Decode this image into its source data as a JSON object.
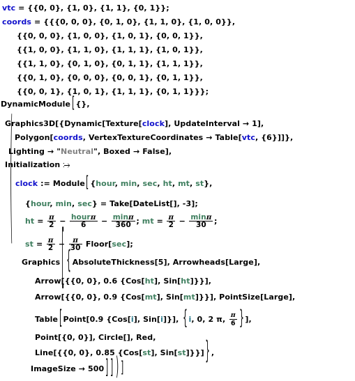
{
  "meta": {
    "app": "Wolfram Mathematica",
    "cell_type": "Input",
    "language": "Wolfram Language"
  },
  "colors": {
    "global_symbol": "#1111cc",
    "local_symbol": "#3f7f5f",
    "iterator_symbol": "#2b7a8c",
    "string_literal": "#808080",
    "default_text": "#000000",
    "background": "#ffffff"
  },
  "code": {
    "line01": {
      "name_vtc": "vtc",
      "rest": " = {{0, 0}, {1, 0}, {1, 1}, {0, 1}};"
    },
    "line02": {
      "name_coords": "coords",
      "rest": " = {{{0, 0, 0}, {0, 1, 0}, {1, 1, 0}, {1, 0, 0}},"
    },
    "line03": "{{0, 0, 0}, {1, 0, 0}, {1, 0, 1}, {0, 0, 1}},",
    "line04": "{{1, 0, 0}, {1, 1, 0}, {1, 1, 1}, {1, 0, 1}},",
    "line05": "{{1, 1, 0}, {0, 1, 0}, {0, 1, 1}, {1, 1, 1}},",
    "line06": "{{0, 1, 0}, {0, 0, 0}, {0, 0, 1}, {0, 1, 1}},",
    "line07": "{{0, 0, 1}, {1, 0, 1}, {1, 1, 1}, {0, 1, 1}}};",
    "line08": {
      "head": "DynamicModule",
      "bracket": "[",
      "args": "{},"
    },
    "line09": {
      "pre": "Graphics3D[{Dynamic[Texture[",
      "sym": "clock",
      "post": "], UpdateInterval → 1],"
    },
    "line10": {
      "pre": "Polygon[",
      "sym1": "coords",
      "mid": ", VertexTextureCoordinates → Table[",
      "sym2": "vtc",
      "post": ", {6}]]},"
    },
    "line11": {
      "pre": "Lighting → \"",
      "str": "Neutral",
      "post": "\", Boxed → False],"
    },
    "line12": {
      "label": "Initialization",
      "op": " ⧴"
    },
    "line13": {
      "paren": "(",
      "sym": "clock",
      "assign": " := Module",
      "bracket": "[",
      "locals_open": "{",
      "l1": "hour",
      "c1": ", ",
      "l2": "min",
      "c2": ", ",
      "l3": "sec",
      "c3": ", ",
      "l4": "ht",
      "c4": ", ",
      "l5": "mt",
      "c5": ", ",
      "l6": "st",
      "locals_close": "},"
    },
    "line14": {
      "open": "{",
      "l1": "hour",
      "c1": ", ",
      "l2": "min",
      "c2": ", ",
      "l3": "sec",
      "close": "} = Take[DateList[], -3];"
    },
    "line15": {
      "lhs": "ht",
      "eq": " = ",
      "f1_num": "π",
      "f1_den": "2",
      "minus1": " − ",
      "f2_num_sym": "hour",
      "f2_num_pi": "π",
      "f2_den": "6",
      "minus2": " − ",
      "f3_num_sym": "min",
      "f3_num_pi": "π",
      "f3_den": "360",
      "semi": "; ",
      "lhs2": "mt",
      "eq2": " = ",
      "f4_num": "π",
      "f4_den": "2",
      "minus3": " − ",
      "f5_num_sym": "min",
      "f5_num_pi": "π",
      "f5_den": "30",
      "end": ";"
    },
    "line16": {
      "lhs": "st",
      "eq": " = ",
      "f1_num": "π",
      "f1_den": "2",
      "minus": " − ",
      "f2_num": "π",
      "f2_den": "30",
      "fn": " Floor[",
      "sym": "sec",
      "end": "];"
    },
    "line17": {
      "head": "Graphics",
      "b1": "[",
      "b2": "{",
      "rest": "AbsoluteThickness[5], Arrowheads[Large],"
    },
    "line18": {
      "pre": "Arrow[{{0, 0}, 0.6 {Cos[",
      "s1": "ht",
      "mid": "], Sin[",
      "s2": "ht",
      "post": "]}}],"
    },
    "line19": {
      "pre": "Arrow[{{0, 0}, 0.9 {Cos[",
      "s1": "mt",
      "mid": "], Sin[",
      "s2": "mt",
      "post": "]}}], PointSize[Large],"
    },
    "line20": {
      "head": "Table",
      "b1": "[",
      "pre": "Point[0.9 {Cos[",
      "i1": "i",
      "mid": "], Sin[",
      "i2": "i",
      "post": "]}], ",
      "ib": "{",
      "i3": "i",
      "irange": ", 0, 2 π, ",
      "f_num": "π",
      "f_den": "6",
      "ibc": "}",
      "end": "],"
    },
    "line21": "Point[{0, 0}], Circle[], Red,",
    "line22": {
      "pre": "Line[{{0, 0}, 0.85 {Cos[",
      "s1": "st",
      "mid": "], Sin[",
      "s2": "st",
      "post": "]}}]",
      "closebrace": "}",
      "comma": ","
    },
    "line23": {
      "text": "ImageSize → 500",
      "b1": "]",
      "b2": "]",
      "b3": ")",
      "b4": "]"
    }
  }
}
